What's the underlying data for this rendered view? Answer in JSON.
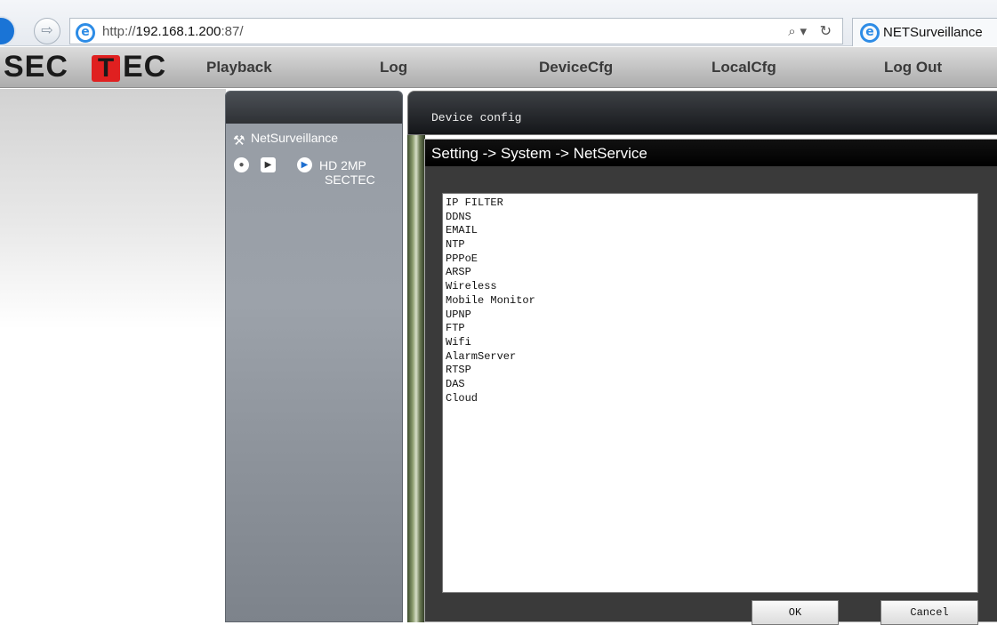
{
  "browser": {
    "url_prefix": "http://",
    "url_host": "192.168.1.200",
    "url_suffix": ":87/",
    "search_glyph": "⌕ ▾",
    "refresh_glyph": "↻",
    "tab_title": "NETSurveillance"
  },
  "logo": {
    "left": "SEC",
    "t": "T",
    "right": "EC"
  },
  "nav": {
    "items": [
      {
        "label": "Playback"
      },
      {
        "label": "Log"
      },
      {
        "label": "DeviceCfg"
      },
      {
        "label": "LocalCfg"
      },
      {
        "label": "Log Out"
      }
    ]
  },
  "device_panel": {
    "name": "NetSurveillance",
    "camera_line1": "HD 2MP",
    "camera_line2": "SECTEC"
  },
  "dialog": {
    "outer_title": "Device config",
    "inner_title": "Setting -> System -> NetService",
    "services": [
      "IP FILTER",
      "DDNS",
      "EMAIL",
      "NTP",
      "PPPoE",
      "ARSP",
      "Wireless",
      "Mobile Monitor",
      "UPNP",
      "FTP",
      "Wifi",
      "AlarmServer",
      "RTSP",
      "DAS",
      "Cloud"
    ],
    "ok_label": "OK",
    "cancel_label": "Cancel"
  }
}
